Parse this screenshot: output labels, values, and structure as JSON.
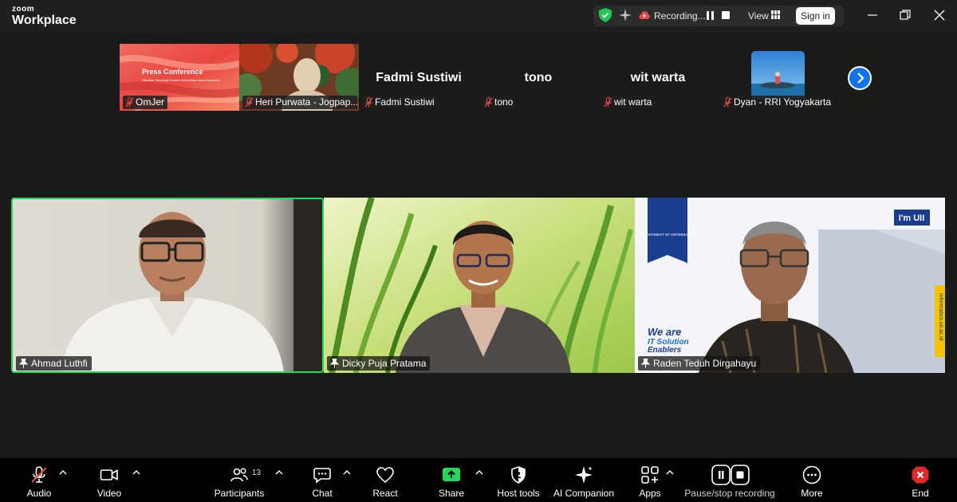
{
  "app": {
    "brand_top": "zoom",
    "brand_bottom": "Workplace"
  },
  "titlebar": {
    "recording_text": "Recording...",
    "view_label": "View",
    "signin_label": "Sign in"
  },
  "thumbnails": [
    {
      "name": "OmJer",
      "slide_title": "Press Conference",
      "slide_sub": "Fakultas Teknologi Industri Universitas Islam Indonesia"
    },
    {
      "name": "Heri Purwata - Jogpap..."
    },
    {
      "name": "Fadmi Sustiwi",
      "display": "Fadmi Sustiwi"
    },
    {
      "name": "tono",
      "display": "tono"
    },
    {
      "name": "wit warta",
      "display": "wit warta"
    },
    {
      "name": "Dyan - RRI Yogyakarta"
    }
  ],
  "gallery": [
    {
      "name": "Ahmad Luthfi"
    },
    {
      "name": "Dicky Puja Pratama"
    },
    {
      "name": "Raden Teduh Dirgahayu",
      "brand": "I'm UII",
      "dept": "DEPARTMENT OF INFORMATICS",
      "tagline_1": "We are",
      "tagline_2": "IT Solution",
      "tagline_3": "Enablers",
      "site": "informatics.uii.ac.id"
    }
  ],
  "toolbar": {
    "audio": "Audio",
    "video": "Video",
    "participants": "Participants",
    "participants_count": "13",
    "chat": "Chat",
    "react": "React",
    "share": "Share",
    "host_tools": "Host tools",
    "ai_companion": "AI Companion",
    "apps": "Apps",
    "pause_stop": "Pause/stop recording",
    "more": "More",
    "end": "End"
  },
  "colors": {
    "active_speaker": "#23d959",
    "share": "#23d959",
    "accent": "#0e72ed",
    "end": "#e02828"
  }
}
